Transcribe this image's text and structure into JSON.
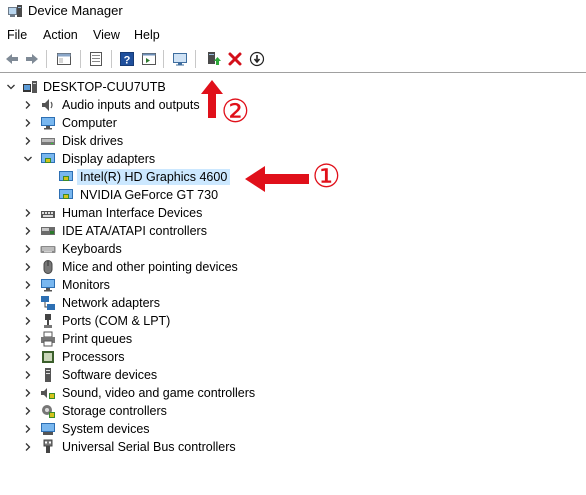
{
  "window": {
    "title": "Device Manager"
  },
  "menu": [
    "File",
    "Action",
    "View",
    "Help"
  ],
  "toolbar": {
    "buttons": [
      "back-icon",
      "forward-icon",
      "properties-sheet-icon",
      "console-tree-icon",
      "help-icon",
      "action-pane-icon",
      "scan-hardware-icon",
      "update-driver-icon",
      "uninstall-device-icon",
      "disable-device-icon"
    ]
  },
  "tree": {
    "root": "DESKTOP-CUU7UTB",
    "items": [
      {
        "label": "Audio inputs and outputs",
        "icon": "speaker-icon"
      },
      {
        "label": "Computer",
        "icon": "monitor-icon"
      },
      {
        "label": "Disk drives",
        "icon": "disk-drive-icon"
      },
      {
        "label": "Display adapters",
        "icon": "display-adapter-icon",
        "children": [
          "Intel(R) HD Graphics 4600",
          "NVIDIA GeForce GT 730"
        ]
      },
      {
        "label": "Human Interface Devices",
        "icon": "hid-icon"
      },
      {
        "label": "IDE ATA/ATAPI controllers",
        "icon": "ide-icon"
      },
      {
        "label": "Keyboards",
        "icon": "keyboard-icon"
      },
      {
        "label": "Mice and other pointing devices",
        "icon": "mouse-icon"
      },
      {
        "label": "Monitors",
        "icon": "monitor-icon"
      },
      {
        "label": "Network adapters",
        "icon": "network-adapter-icon"
      },
      {
        "label": "Ports (COM & LPT)",
        "icon": "port-icon"
      },
      {
        "label": "Print queues",
        "icon": "printer-icon"
      },
      {
        "label": "Processors",
        "icon": "processor-icon"
      },
      {
        "label": "Software devices",
        "icon": "software-device-icon"
      },
      {
        "label": "Sound, video and game controllers",
        "icon": "sound-controller-icon"
      },
      {
        "label": "Storage controllers",
        "icon": "storage-controller-icon"
      },
      {
        "label": "System devices",
        "icon": "system-device-icon"
      },
      {
        "label": "Universal Serial Bus controllers",
        "icon": "usb-icon"
      }
    ]
  },
  "annotations": {
    "one": "①",
    "two": "②",
    "color": "#e0101a"
  },
  "colors": {
    "selection": "#cce8ff",
    "uninstall_x": "#d3101a",
    "update_green": "#2fa83a"
  }
}
